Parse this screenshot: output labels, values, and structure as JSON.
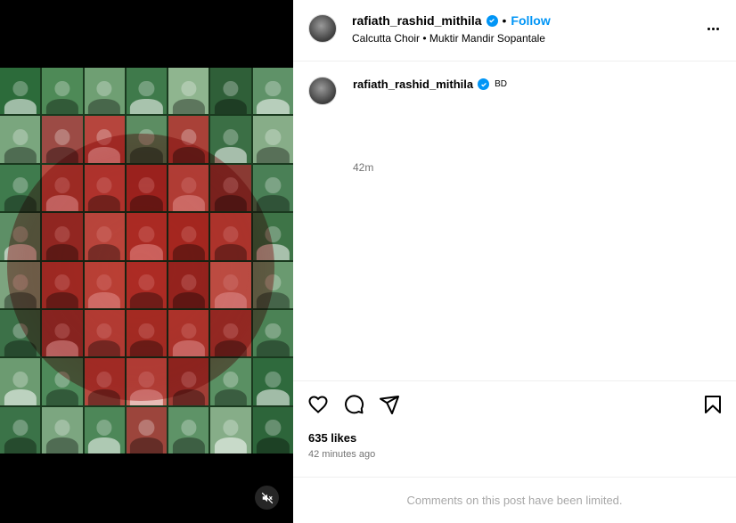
{
  "post": {
    "media": {
      "tiles": [
        "#2c6b3a",
        "#4e8a57",
        "#6f9f73",
        "#3f7a4b",
        "#8fb58f",
        "#2f5f38",
        "#5f9268",
        "#7aa67e",
        "#9c4b45",
        "#b6453d",
        "#5c8d62",
        "#a94138",
        "#3b6f45",
        "#87ad88",
        "#3f7b4d",
        "#b34a3f",
        "#c75a4f",
        "#b03b34",
        "#c96b5e",
        "#8a3a33",
        "#4a8056",
        "#5d8f66",
        "#a5443b",
        "#d07a6b",
        "#bf4b40",
        "#b94438",
        "#c45b4d",
        "#3e7447",
        "#7da47f",
        "#b3473c",
        "#cf7060",
        "#c04c42",
        "#a63d35",
        "#d58676",
        "#6a9a70",
        "#3c7148",
        "#9a3f38",
        "#c9685b",
        "#b84a3e",
        "#c25a4c",
        "#a8463c",
        "#4b8255",
        "#6c9b71",
        "#4e8a5a",
        "#b74a40",
        "#c96a5d",
        "#a13e36",
        "#5a9063",
        "#2f6a3d",
        "#3b7348",
        "#7ca680",
        "#4d8758",
        "#9c453c",
        "#5e9367",
        "#86ad88",
        "#2d653a"
      ]
    },
    "header": {
      "username": "rafiath_rashid_mithila",
      "separator": "•",
      "follow_label": "Follow",
      "location": "Calcutta Choir • Muktir Mandir Sopantale"
    },
    "caption": {
      "username": "rafiath_rashid_mithila",
      "country": "BD",
      "time": "42m"
    },
    "stats": {
      "likes": "635 likes",
      "posted": "42 minutes ago"
    },
    "comments_notice": "Comments on this post have been limited.",
    "colors": {
      "accent": "#0095f6",
      "muted_text": "#737373",
      "limited_text": "#a8a8a8",
      "media_bg": "#000000",
      "circle_red": "#d23228"
    },
    "icons": [
      "heart-icon",
      "comment-icon",
      "share-icon",
      "bookmark-icon",
      "more-icon",
      "verified-icon",
      "mute-icon"
    ]
  }
}
